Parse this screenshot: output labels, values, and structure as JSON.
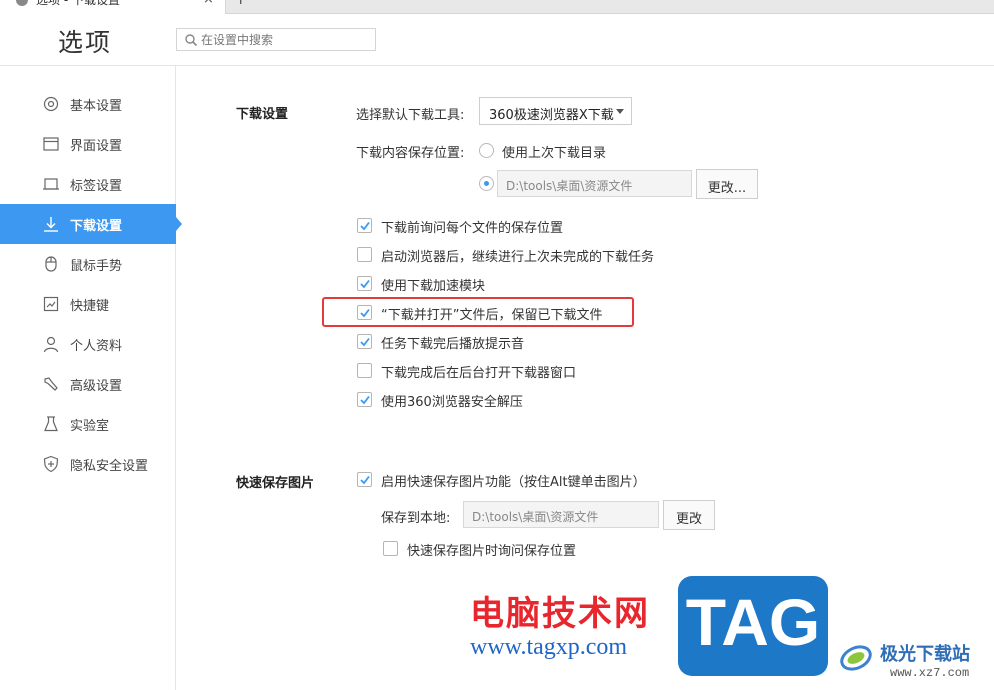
{
  "tab": {
    "title": "选项 - 下载设置",
    "close": "×",
    "new": "+"
  },
  "header": {
    "title": "选项",
    "search_placeholder": "在设置中搜索"
  },
  "sidebar": {
    "items": [
      {
        "label": "基本设置",
        "icon": "gear-icon"
      },
      {
        "label": "界面设置",
        "icon": "window-icon"
      },
      {
        "label": "标签设置",
        "icon": "tab-icon"
      },
      {
        "label": "下载设置",
        "icon": "download-icon",
        "active": true
      },
      {
        "label": "鼠标手势",
        "icon": "mouse-icon"
      },
      {
        "label": "快捷键",
        "icon": "keyboard-icon"
      },
      {
        "label": "个人资料",
        "icon": "user-icon"
      },
      {
        "label": "高级设置",
        "icon": "wrench-icon"
      },
      {
        "label": "实验室",
        "icon": "flask-icon"
      },
      {
        "label": "隐私安全设置",
        "icon": "shield-icon"
      }
    ]
  },
  "download": {
    "section_title": "下载设置",
    "tool_label": "选择默认下载工具:",
    "tool_value": "360极速浏览器X下载",
    "location_label": "下载内容保存位置:",
    "radio_last_dir": "使用上次下载目录",
    "path": "D:\\tools\\桌面\\资源文件",
    "change_button": "更改...",
    "options": [
      {
        "label": "下载前询问每个文件的保存位置",
        "checked": true
      },
      {
        "label": "启动浏览器后，继续进行上次未完成的下载任务",
        "checked": false
      },
      {
        "label": "使用下载加速模块",
        "checked": true
      },
      {
        "label": "“下载并打开”文件后，保留已下载文件",
        "checked": true
      },
      {
        "label": "任务下载完后播放提示音",
        "checked": true
      },
      {
        "label": "下载完成后在后台打开下载器窗口",
        "checked": false
      },
      {
        "label": "使用360浏览器安全解压",
        "checked": true
      }
    ]
  },
  "quicksave": {
    "section_title": "快速保存图片",
    "enable_label": "启用快速保存图片功能（按住Alt键单击图片）",
    "enable_checked": true,
    "save_to_label": "保存到本地:",
    "path": "D:\\tools\\桌面\\资源文件",
    "change_button": "更改",
    "ask_label": "快速保存图片时询问保存位置",
    "ask_checked": false
  },
  "watermark": {
    "cn": "电脑技术网",
    "url": "www.tagxp.com",
    "tag": "TAG",
    "site": "极光下载站",
    "site_url": "www.xz7.com"
  },
  "colors": {
    "accent": "#3c98f0",
    "highlight": "#e23b3b"
  }
}
